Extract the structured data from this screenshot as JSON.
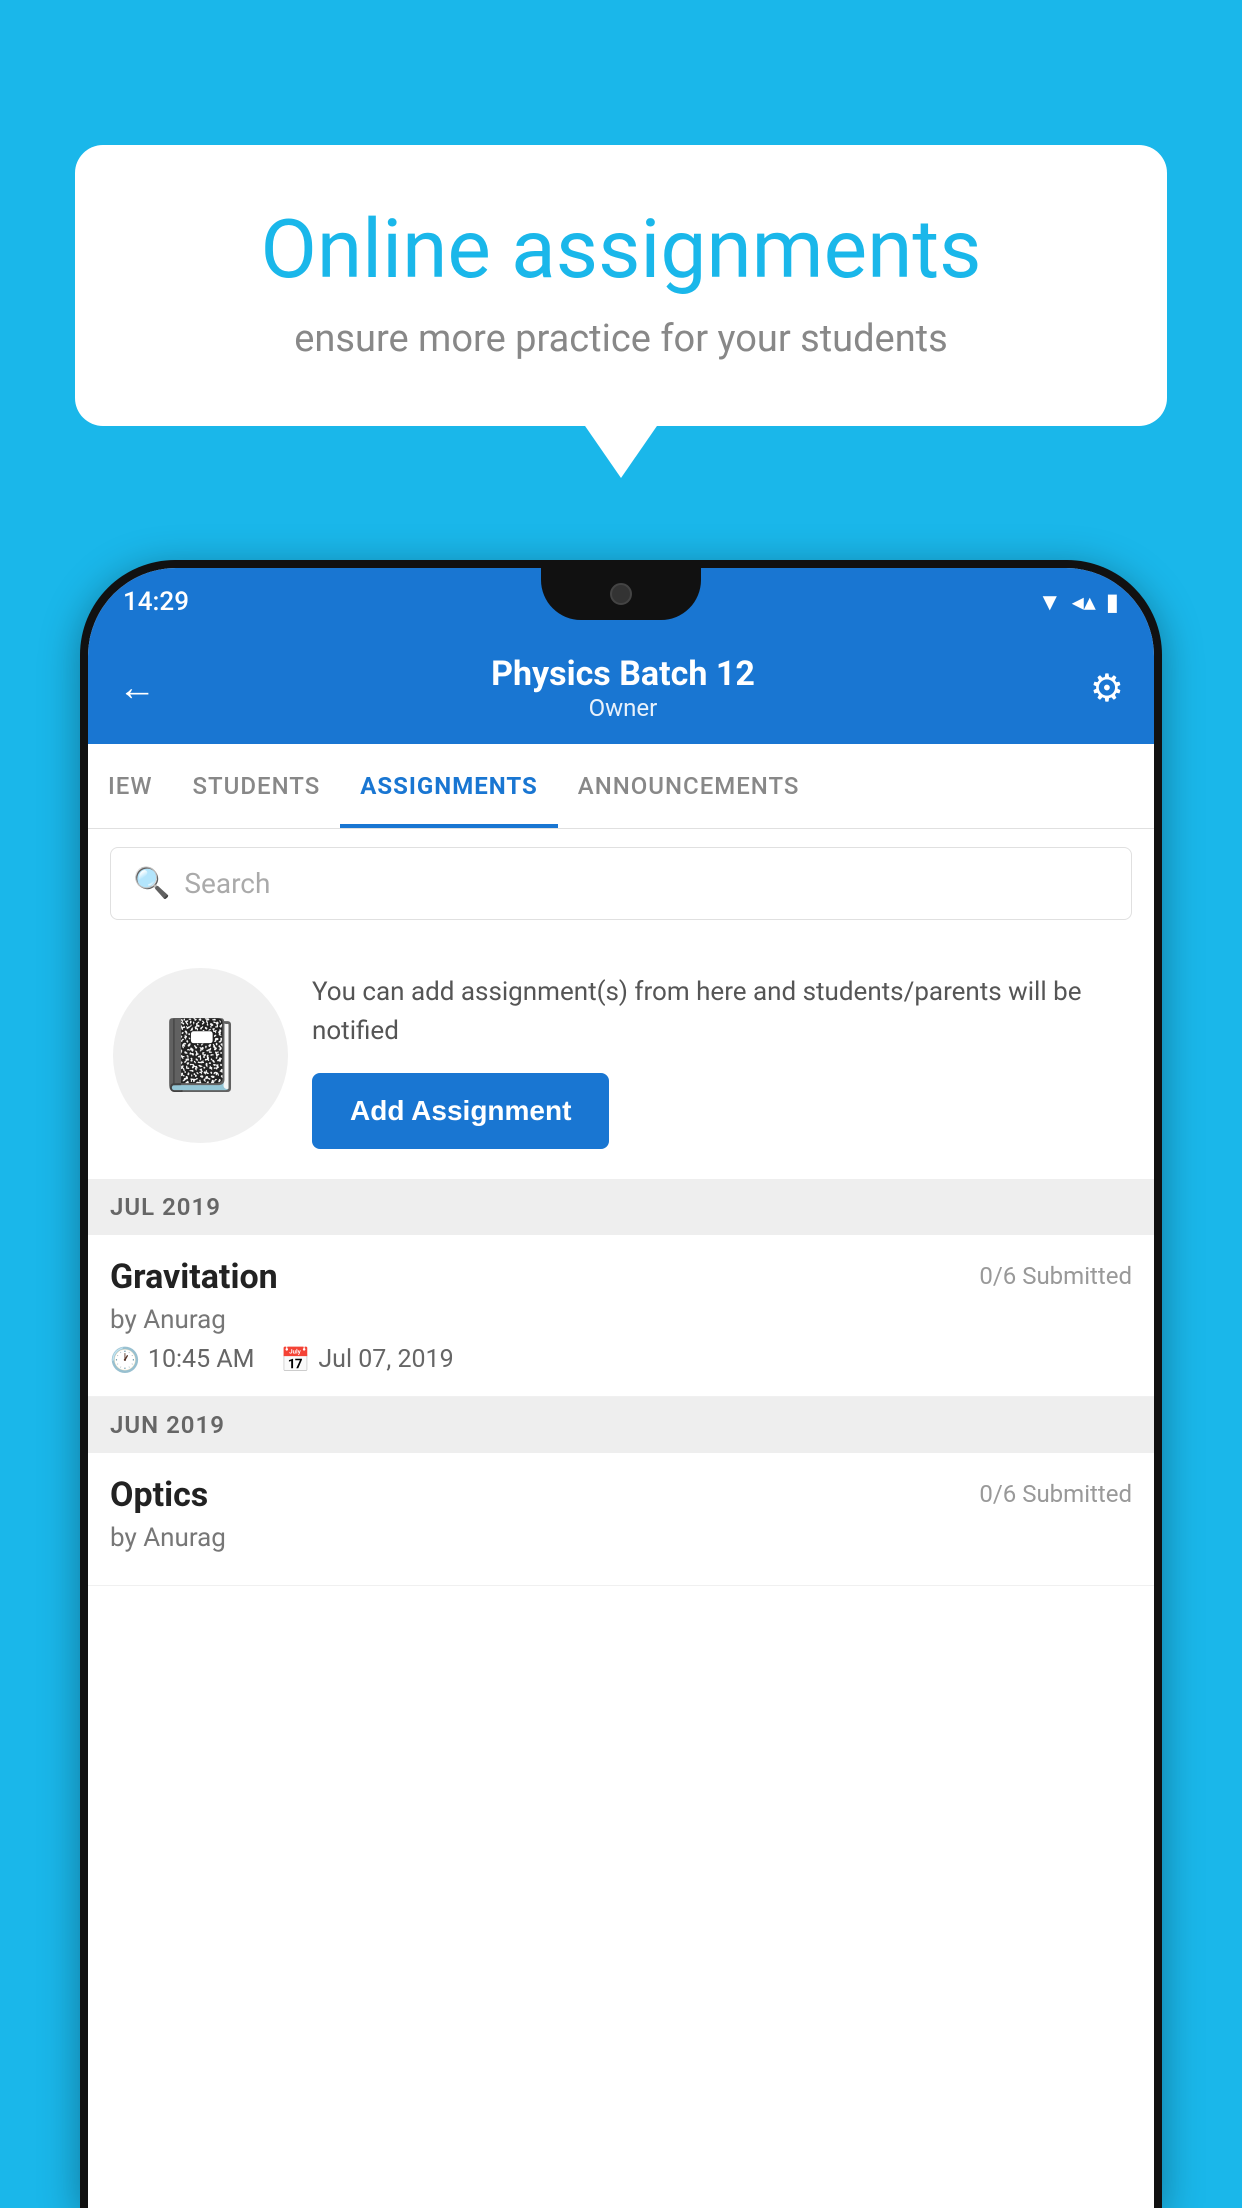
{
  "background_color": "#1ab7ea",
  "speech_bubble": {
    "title": "Online assignments",
    "subtitle": "ensure more practice for your students"
  },
  "phone": {
    "status_bar": {
      "time": "14:29",
      "icons": [
        "wifi",
        "signal",
        "battery"
      ]
    },
    "header": {
      "title": "Physics Batch 12",
      "subtitle": "Owner",
      "back_label": "←",
      "settings_label": "⚙"
    },
    "tabs": [
      {
        "label": "IEW",
        "active": false
      },
      {
        "label": "STUDENTS",
        "active": false
      },
      {
        "label": "ASSIGNMENTS",
        "active": true
      },
      {
        "label": "ANNOUNCEMENTS",
        "active": false
      }
    ],
    "search": {
      "placeholder": "Search"
    },
    "promo": {
      "text": "You can add assignment(s) from here and students/parents will be notified",
      "button_label": "Add Assignment"
    },
    "sections": [
      {
        "month_label": "JUL 2019",
        "assignments": [
          {
            "name": "Gravitation",
            "submitted": "0/6 Submitted",
            "by": "by Anurag",
            "time": "10:45 AM",
            "date": "Jul 07, 2019"
          }
        ]
      },
      {
        "month_label": "JUN 2019",
        "assignments": [
          {
            "name": "Optics",
            "submitted": "0/6 Submitted",
            "by": "by Anurag",
            "time": "",
            "date": ""
          }
        ]
      }
    ]
  }
}
